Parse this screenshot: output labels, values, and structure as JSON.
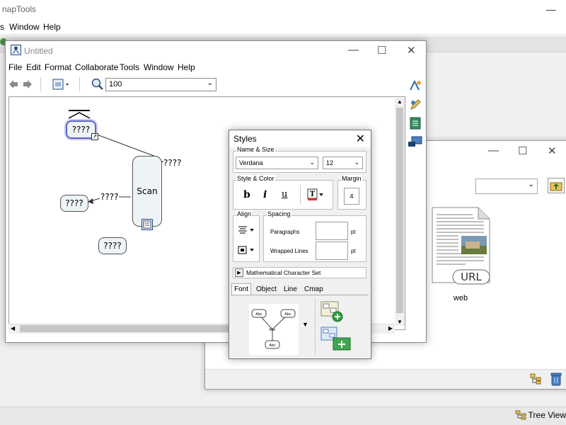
{
  "app": {
    "title": "napTools",
    "menu": [
      "s",
      "Window",
      "Help"
    ],
    "status": {
      "tree_view_label": "Tree View"
    }
  },
  "resources_window": {
    "file": {
      "name": "web",
      "badge": "URL"
    }
  },
  "cmap_window": {
    "title": "Untitled",
    "menu": [
      "File",
      "Edit",
      "Format",
      "Collaborate",
      "Tools",
      "Window",
      "Help"
    ],
    "zoom": "100",
    "concepts": [
      {
        "label": "????"
      },
      {
        "label": "Scan"
      },
      {
        "label": "????"
      },
      {
        "label": "????"
      }
    ],
    "links": [
      {
        "label": "????"
      },
      {
        "label": "????"
      }
    ]
  },
  "styles_palette": {
    "title": "Styles",
    "name_size": {
      "label": "Name & Size",
      "font": "Verdana",
      "size": "12"
    },
    "style_color": {
      "label": "Style & Color",
      "bold": "b",
      "italic": "i",
      "underline": "u"
    },
    "margin": {
      "label": "Margin",
      "value": "4"
    },
    "align": {
      "label": "Align"
    },
    "spacing": {
      "label": "Spacing",
      "paragraphs": "Paragraphs",
      "wrapped_lines": "Wrapped Lines",
      "unit": "pt"
    },
    "math_charset": "Mathematical Character Set",
    "tabs": [
      "Font",
      "Object",
      "Line",
      "Cmap"
    ],
    "active_tab": "Font",
    "thumbnail_labels": [
      "Abc",
      "Abc",
      "Abc",
      "Abc"
    ]
  }
}
